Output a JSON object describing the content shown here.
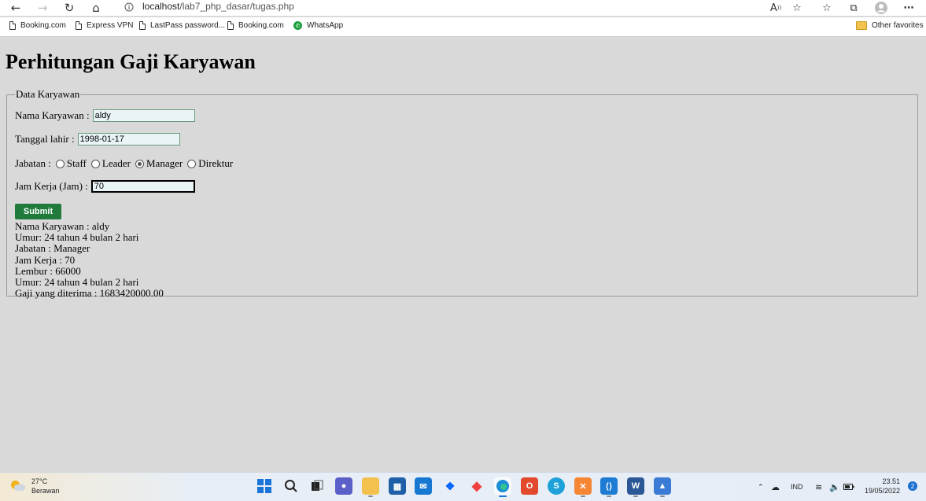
{
  "browser": {
    "url_host": "localhost",
    "url_path": "/lab7_php_dasar/tugas.php",
    "bookmarks": [
      "Booking.com",
      "Express VPN",
      "LastPass password...",
      "Booking.com",
      "WhatsApp"
    ],
    "other_favorites": "Other favorites"
  },
  "page": {
    "title": "Perhitungan Gaji Karyawan",
    "legend": "Data Karyawan",
    "form": {
      "name_label": "Nama Karyawan :",
      "name_value": "aldy",
      "dob_label": "Tanggal lahir :",
      "dob_value": "1998-01-17",
      "role_label": "Jabatan :",
      "roles": [
        "Staff",
        "Leader",
        "Manager",
        "Direktur"
      ],
      "selected_role": "Manager",
      "hours_label": "Jam Kerja (Jam) :",
      "hours_value": "70",
      "submit": "Submit"
    },
    "result": [
      "Nama Karyawan : aldy",
      "Umur: 24 tahun 4 bulan 2 hari",
      "Jabatan : Manager",
      "Jam Kerja : 70",
      "Lembur : 66000",
      "Umur: 24 tahun 4 bulan 2 hari",
      "Gaji yang diterima : 1683420000.00"
    ]
  },
  "taskbar": {
    "temp": "27°C",
    "weather": "Berawan",
    "lang": "IND",
    "time": "23.51",
    "date": "19/05/2022",
    "notifications": "2"
  }
}
